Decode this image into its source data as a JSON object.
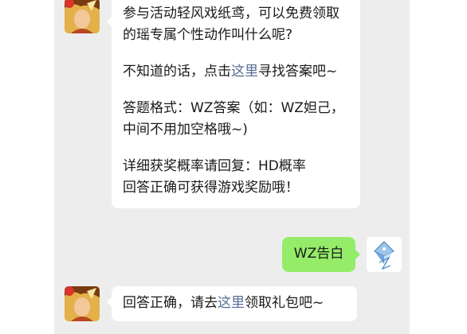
{
  "colors": {
    "chat_bg": "#ededed",
    "bubble_in": "#ffffff",
    "bubble_out": "#95ec69",
    "link": "#576b95",
    "text": "#1a1a1a"
  },
  "messages": {
    "m1": {
      "sender": "official-account",
      "avatar_icon": "game-hero-avatar-icon",
      "p1": "参与活动轻风戏纸鸢，可以免费领取的瑶专属个性动作叫什么呢?",
      "p2_pre": "不知道的话，点击",
      "p2_link": "这里",
      "p2_post": "寻找答案吧~",
      "p3": "答题格式：WZ答案（如：WZ妲己，中间不用加空格哦~)",
      "p4a": "详细获奖概率请回复：HD概率",
      "p4b": "回答正确可获得游戏奖励哦！"
    },
    "m2": {
      "sender": "user",
      "avatar_icon": "user-crystal-avatar-icon",
      "text": "WZ告白"
    },
    "m3": {
      "sender": "official-account",
      "avatar_icon": "game-hero-avatar-icon",
      "pre": "回答正确，请去",
      "link": "这里",
      "post": "领取礼包吧~"
    }
  }
}
